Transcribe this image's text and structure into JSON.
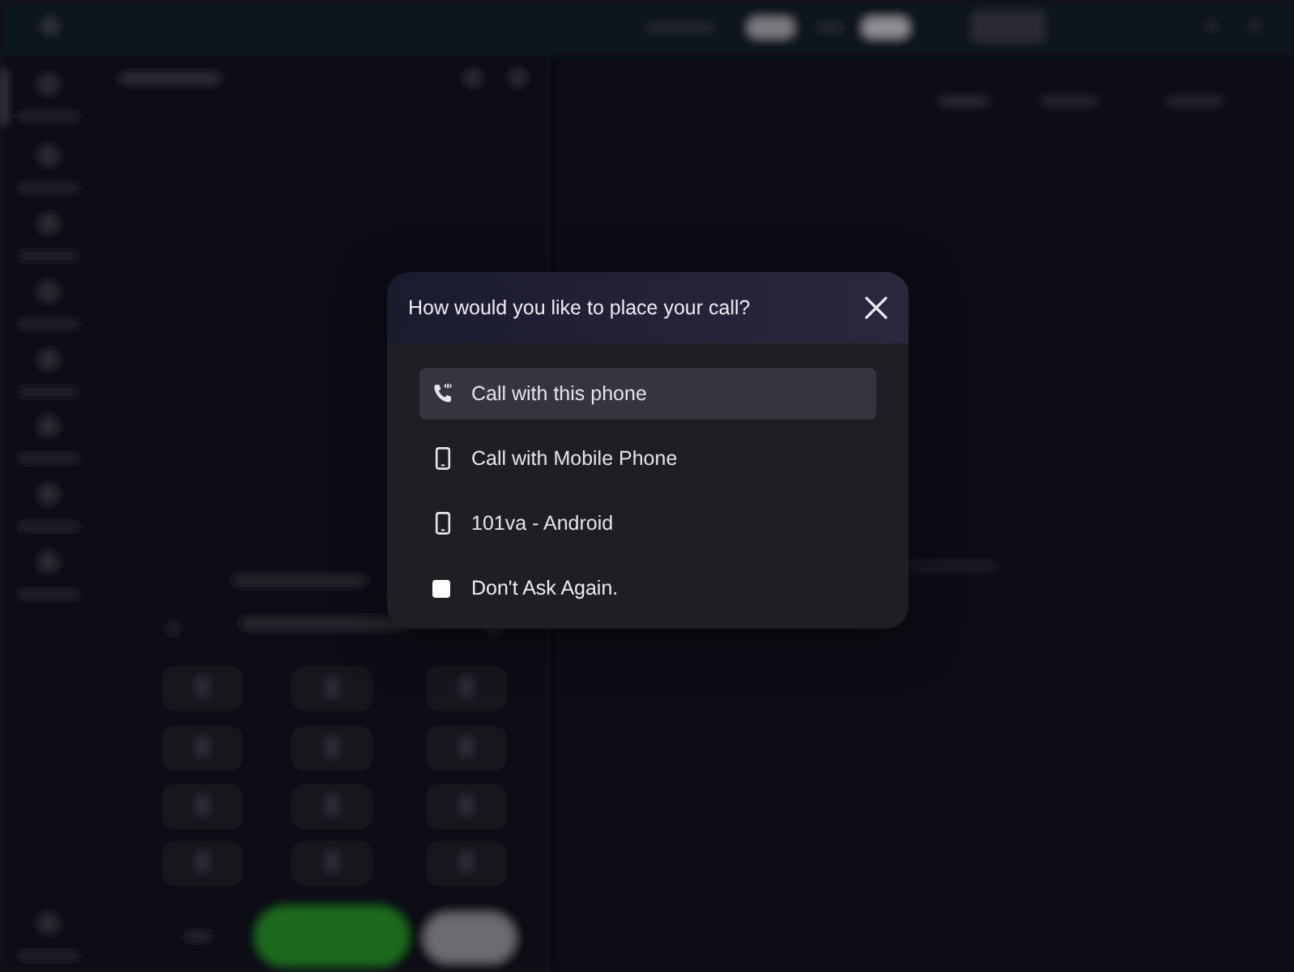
{
  "dialog": {
    "title": "How would you like to place your call?",
    "options": [
      {
        "kind": "voip",
        "label": "Call with this phone",
        "selected": true
      },
      {
        "kind": "mobile",
        "label": "Call with Mobile Phone",
        "selected": false
      },
      {
        "kind": "mobile",
        "label": "101va - Android",
        "selected": false
      }
    ],
    "dont_ask_again": {
      "label": "Don't Ask Again.",
      "checked": false
    }
  }
}
